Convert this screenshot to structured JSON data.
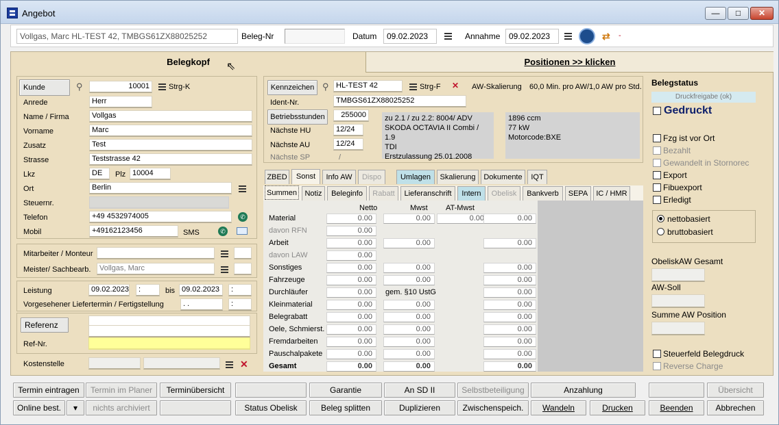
{
  "window": {
    "title": "Angebot",
    "btn_min": "—",
    "btn_max": "□",
    "btn_close": "✕"
  },
  "topbar": {
    "customer_vehicle": "Vollgas, Marc HL-TEST 42, TMBGS61ZX88025252",
    "belegnr_label": "Beleg-Nr",
    "belegnr_value": "",
    "datum_label": "Datum",
    "datum_value": "09.02.2023",
    "annahme_label": "Annahme",
    "annahme_value": "09.02.2023",
    "dash": "-"
  },
  "tabs": {
    "belegkopf": "Belegkopf",
    "positionen": "Positionen >> klicken"
  },
  "kunde": {
    "button": "Kunde",
    "number": "10001",
    "strg": "Strg-K",
    "fields": [
      {
        "label": "Anrede",
        "value": "Herr"
      },
      {
        "label": "Name / Firma",
        "value": "Vollgas"
      },
      {
        "label": "Vorname",
        "value": "Marc"
      },
      {
        "label": "Zusatz",
        "value": "Test"
      },
      {
        "label": "Strasse",
        "value": "Teststrasse 42"
      }
    ],
    "lkz_label": "Lkz",
    "lkz_value": "DE",
    "plz_label": "Plz",
    "plz_value": "10004",
    "ort_label": "Ort",
    "ort_value": "Berlin",
    "steuernr_label": "Steuernr.",
    "steuernr_value": "",
    "telefon_label": "Telefon",
    "telefon_value": "+49 4532974005",
    "mobil_label": "Mobil",
    "mobil_value": "+49162123456",
    "sms": "SMS"
  },
  "staff": {
    "mitarbeiter_label": "Mitarbeiter / Monteur",
    "mitarbeiter_value": "",
    "meister_label": "Meister/ Sachbearb.",
    "meister_value": "Vollgas, Marc"
  },
  "leistung": {
    "label": "Leistung",
    "from": "09.02.2023",
    "from_time": ":",
    "bis": "bis",
    "to": "09.02.2023",
    "to_time": ":",
    "liefer_label": "Vorgesehener Liefertermin / Fertigstellung",
    "liefer_date": ". .",
    "liefer_time": ":"
  },
  "referenz": {
    "button": "Referenz",
    "refnr_label": "Ref-Nr."
  },
  "kostenstelle": {
    "label": "Kostenstelle"
  },
  "vehicle": {
    "kennzeichen_button": "Kennzeichen",
    "kennzeichen": "HL-TEST 42",
    "strg": "Strg-F",
    "aw_label": "AW-Skalierung",
    "aw_value": "60,0 Min. pro AW/1,0 AW pro Std.",
    "ident_label": "Ident-Nr.",
    "ident": "TMBGS61ZX88025252",
    "betrieb_button": "Betriebsstunden",
    "betrieb_value": "255000",
    "hu_label": "Nächste HU",
    "hu_value": "12/24",
    "au_label": "Nächste AU",
    "au_value": "12/24",
    "sp_label": "Nächste SP",
    "sp_value": "/",
    "info1": [
      "zu 2.1 / zu 2.2: 8004/ ADV",
      "SKODA OCTAVIA II Combi / 1.9",
      "TDI",
      "Erstzulassung 25.01.2008"
    ],
    "info2": [
      "1896 ccm",
      "77 kW",
      "Motorcode:BXE"
    ]
  },
  "tabs_row1": [
    "ZBED",
    "Sonst",
    "Info AW",
    "Dispo",
    "Umlagen",
    "Skalierung",
    "Dokumente",
    "IQT"
  ],
  "tabs_row2": [
    "Summen",
    "Notiz",
    "Beleginfo",
    "Rabatt",
    "Lieferanschrift",
    "Intern",
    "Obelisk",
    "Bankverb",
    "SEPA",
    "IC / HMR"
  ],
  "summen": {
    "headers": [
      "Netto",
      "Mwst",
      "AT-Mwst"
    ],
    "rows": [
      {
        "label": "Material",
        "netto": "0.00",
        "mwst": "0.00",
        "at": "0.00",
        "total": "0.00"
      },
      {
        "label": "davon RFN",
        "netto": "0.00"
      },
      {
        "label": "Arbeit",
        "netto": "0.00",
        "mwst": "0.00",
        "total": "0.00"
      },
      {
        "label": "davon LAW",
        "netto": "0.00"
      },
      {
        "label": "Sonstiges",
        "netto": "0.00",
        "mwst": "0.00",
        "total": "0.00"
      },
      {
        "label": "Fahrzeuge",
        "netto": "0.00",
        "mwst": "0.00",
        "total": "0.00"
      },
      {
        "label": "Durchläufer",
        "netto": "0.00",
        "note": "gem. §10 UstG",
        "total": "0.00"
      },
      {
        "label": "Kleinmaterial",
        "netto": "0.00",
        "mwst": "0.00",
        "total": "0.00"
      },
      {
        "label": "Belegrabatt",
        "netto": "0.00",
        "mwst": "0.00",
        "total": "0.00"
      },
      {
        "label": "Oele, Schmierst.",
        "netto": "0.00",
        "mwst": "0.00",
        "total": "0.00"
      },
      {
        "label": "Fremdarbeiten",
        "netto": "0.00",
        "mwst": "0.00",
        "total": "0.00"
      },
      {
        "label": "Pauschalpakete",
        "netto": "0.00",
        "mwst": "0.00",
        "total": "0.00"
      },
      {
        "label": "Gesamt",
        "netto": "0.00",
        "mwst": "0.00",
        "total": "0.00"
      }
    ]
  },
  "belegstatus": {
    "title": "Belegstatus",
    "druckfreigabe": "Druckfreigabe (ok)",
    "gedruckt": "Gedruckt",
    "checks": [
      "Fzg ist vor Ort",
      "Bezahlt",
      "Gewandelt in Stornorec",
      "Export",
      "Fibuexport",
      "Erledigt"
    ],
    "radio_netto": "nettobasiert",
    "radio_brutto": "bruttobasiert",
    "obelisk_label": "ObeliskAW Gesamt",
    "awsoll_label": "AW-Soll",
    "summe_aw_label": "Summe AW Position",
    "steuerfeld": "Steuerfeld Belegdruck",
    "reverse": "Reverse Charge"
  },
  "buttons_row1": [
    "Termin eintragen",
    "Termin im Planer",
    "Terminübersicht",
    "",
    "Garantie",
    "An SD II",
    "Selbstbeteiligung",
    "Anzahlung",
    "",
    "Übersicht"
  ],
  "buttons_row2": [
    "Online best.",
    "▾",
    "nichts archiviert",
    "",
    "Status Obelisk",
    "Beleg splitten",
    "Duplizieren",
    "Zwischenspeich.",
    "Wandeln",
    "Drucken",
    "Beenden",
    "Abbrechen"
  ]
}
